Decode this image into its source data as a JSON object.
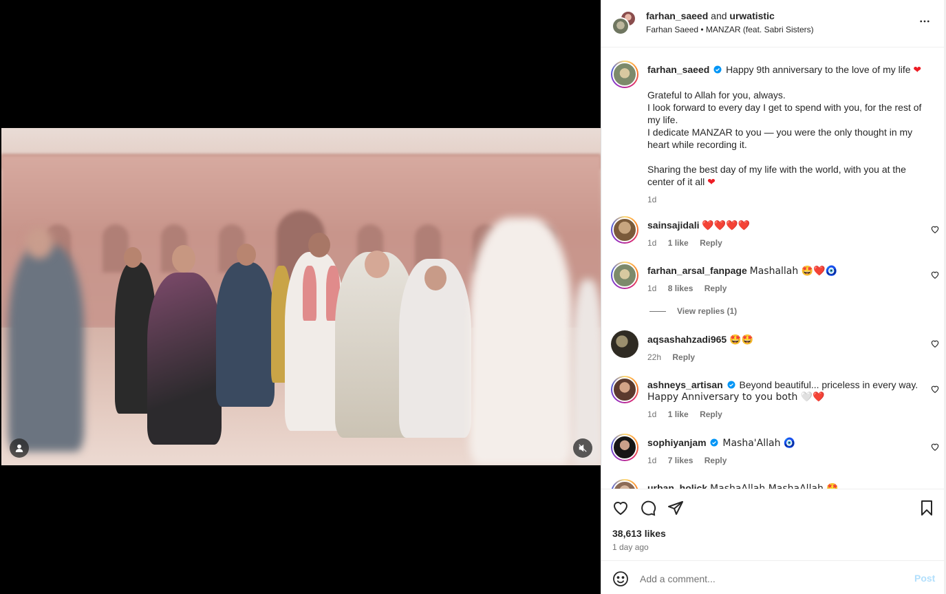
{
  "header": {
    "user1": "farhan_saeed",
    "joiner": "and",
    "user2": "urwatistic",
    "audio": "Farhan Saeed • MANZAR (feat. Sabri Sisters)"
  },
  "caption": {
    "username": "farhan_saeed",
    "first_line": "Happy 9th anniversary to the love of my life",
    "paragraph1": [
      "Grateful to Allah for you, always.",
      "I look forward to every day I get to spend with you, for the rest of my life.",
      "I dedicate MANZAR to you — you were the only thought in my heart while recording it."
    ],
    "paragraph2": "Sharing the best day of my life with the world, with you at the center of it all",
    "time": "1d"
  },
  "comments": [
    {
      "username": "sainsajidali",
      "verified": false,
      "text": "❤️❤️❤️❤️",
      "time": "1d",
      "likes": "1 like",
      "reply": "Reply"
    },
    {
      "username": "farhan_arsal_fanpage",
      "verified": false,
      "text": "Mashallah 🤩❤️🧿",
      "time": "1d",
      "likes": "8 likes",
      "reply": "Reply",
      "view_replies": "View replies (1)"
    },
    {
      "username": "aqsashahzadi965",
      "verified": false,
      "text": "🤩🤩",
      "time": "22h",
      "likes": "",
      "reply": "Reply"
    },
    {
      "username": "ashneys_artisan",
      "verified": true,
      "text": "Beyond beautiful... priceless in every way.",
      "text2": "Happy Anniversary to you both 🤍❤️",
      "time": "1d",
      "likes": "1 like",
      "reply": "Reply"
    },
    {
      "username": "sophiyanjam",
      "verified": true,
      "text": "Masha'Allah 🧿",
      "time": "1d",
      "likes": "7 likes",
      "reply": "Reply"
    },
    {
      "username": "urban_holick",
      "verified": false,
      "text": "MashaAllah MashaAllah 🤩",
      "time": "",
      "likes": "",
      "reply": ""
    }
  ],
  "actions": {
    "likes": "38,613 likes",
    "time_ago": "1 day ago"
  },
  "add_comment": {
    "placeholder": "Add a comment...",
    "post_label": "Post"
  },
  "icons": {
    "more": "more-horizontal-icon",
    "like": "heart-icon",
    "comment": "comment-bubble-icon",
    "share": "paper-plane-icon",
    "save": "bookmark-icon",
    "emoji": "smiley-icon",
    "tag": "user-tag-icon",
    "mute": "speaker-muted-icon",
    "verified": "verified-badge-icon"
  },
  "colors": {
    "verified": "#0095f6",
    "heart": "#ed1c24",
    "post_disabled": "#b2dffc",
    "secondary_text": "#737373"
  }
}
